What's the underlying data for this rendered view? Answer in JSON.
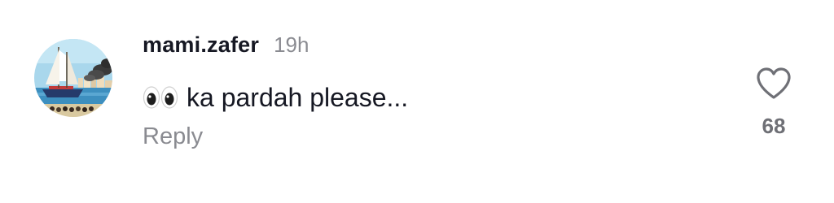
{
  "comment": {
    "username": "mami.zafer",
    "time": "19h",
    "text": "ka pardah please...",
    "text_emoji": "eyes-emoji",
    "reply_label": "Reply",
    "like_count": "68",
    "avatar_subject": "sailing-ship-avatar"
  },
  "colors": {
    "username": "#161823",
    "secondary_text": "#8a8b91",
    "like_count": "#6f7076",
    "heart_outline": "#6f7076",
    "background": "#ffffff"
  }
}
